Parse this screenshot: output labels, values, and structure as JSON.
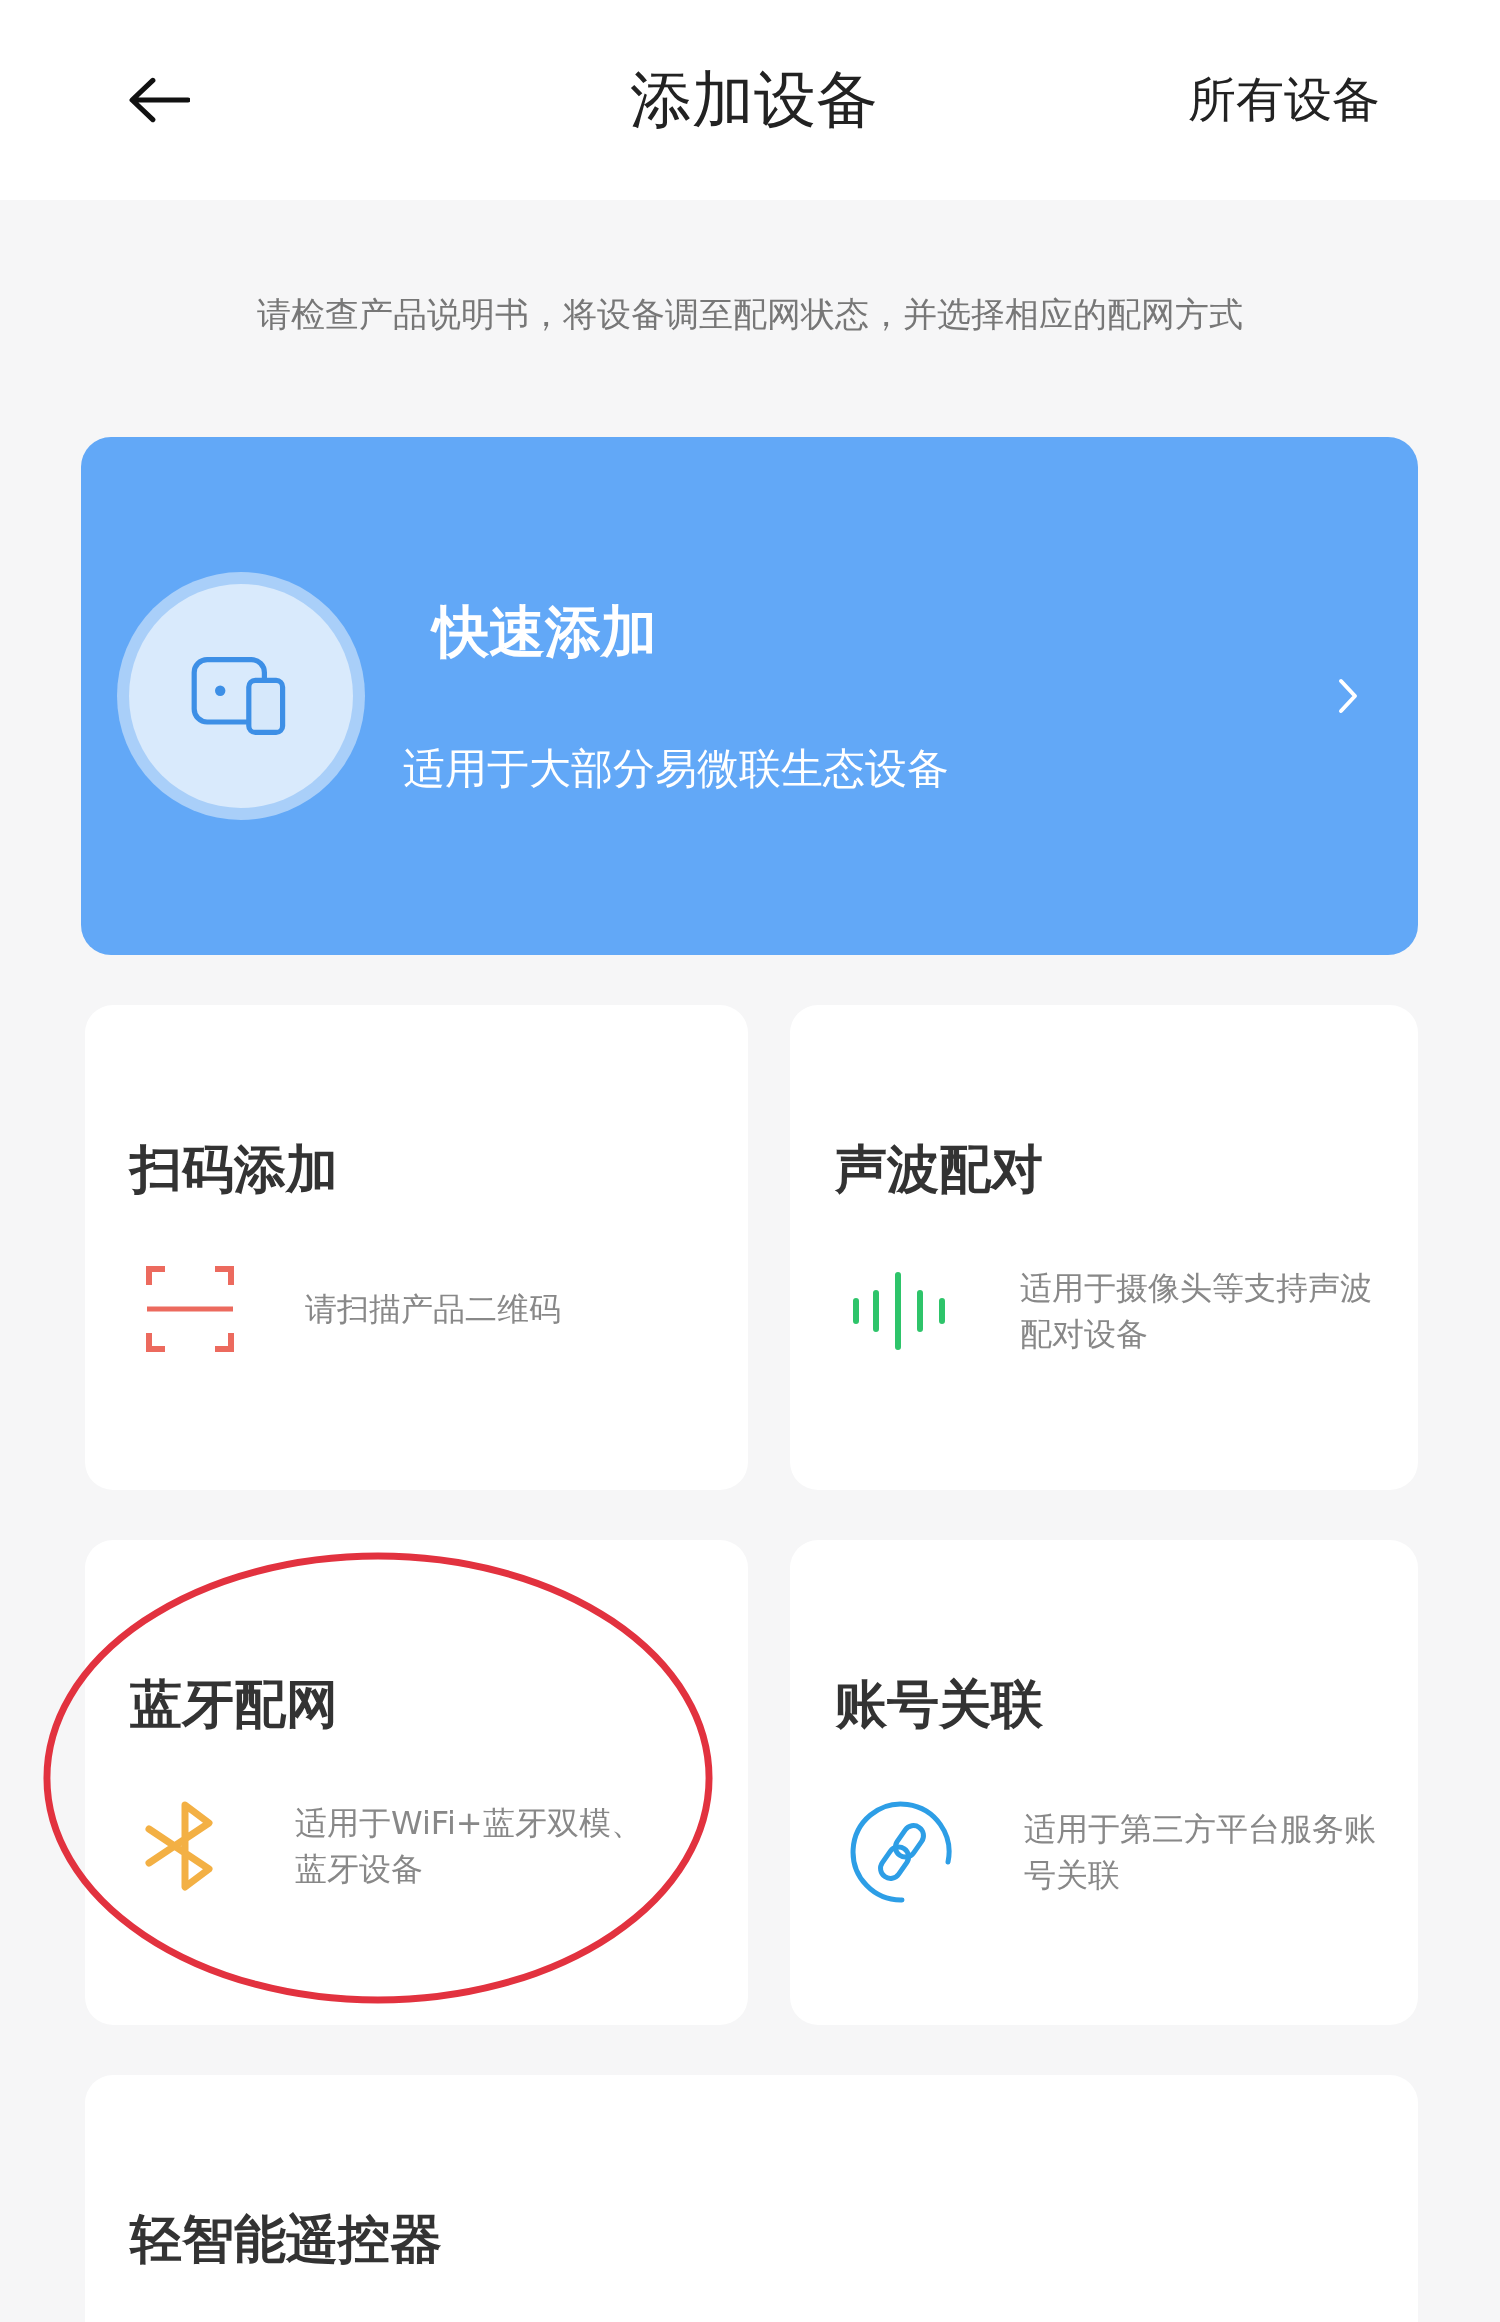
{
  "header": {
    "title": "添加设备",
    "action": "所有设备"
  },
  "hint": "请检查产品说明书，将设备调至配网状态，并选择相应的配网方式",
  "quick_add": {
    "title": "快速添加",
    "description": "适用于大部分易微联生态设备"
  },
  "methods": [
    {
      "kind": "scan",
      "title": "扫码添加",
      "description": "请扫描产品二维码",
      "highlighted": false
    },
    {
      "kind": "sound",
      "title": "声波配对",
      "description": "适用于摄像头等支持声波配对设备",
      "highlighted": false
    },
    {
      "kind": "bluetooth",
      "title": "蓝牙配网",
      "description": "适用于WiFi+蓝牙双模、蓝牙设备",
      "highlighted": true
    },
    {
      "kind": "account",
      "title": "账号关联",
      "description": "适用于第三方平台服务账号关联",
      "highlighted": false
    },
    {
      "kind": "remote",
      "title": "轻智能遥控器",
      "highlighted": false
    }
  ]
}
